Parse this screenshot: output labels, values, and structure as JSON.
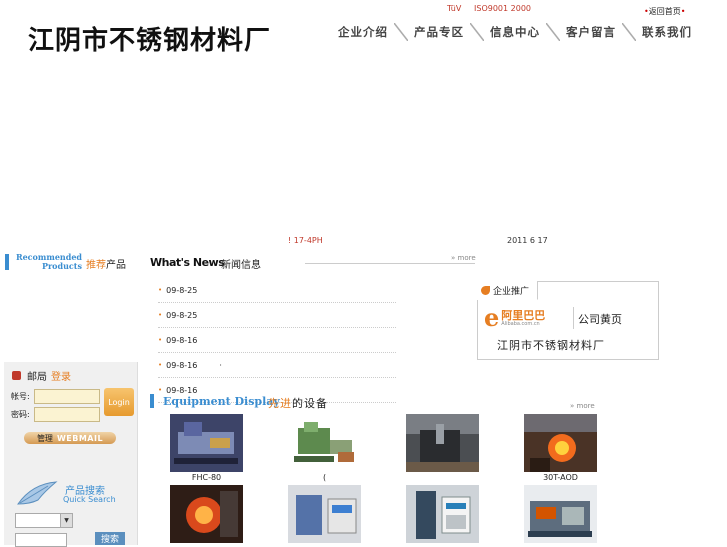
{
  "header": {
    "site_title": "江阴市不锈钢材料厂",
    "cert_tuv": "TüV",
    "cert_iso": "ISO9001 2000",
    "back_home": "返回首页",
    "nav": [
      "企业介绍",
      "产品专区",
      "信息中心",
      "客户留言",
      "联系我们"
    ]
  },
  "info_bar": {
    "hours": "! 17-4PH",
    "date": "2011 6 17"
  },
  "recommended": {
    "title_en_line1": "Recommended",
    "title_en_line2": "Products",
    "title_cn_highlight": "推荐",
    "title_cn_rest": "产品"
  },
  "news": {
    "title_en": "What's News",
    "title_cn": "新闻信息",
    "more": "more",
    "items": [
      "09-8-25",
      "09-8-25",
      "09-8-16",
      "09-8-16",
      "09-8-16"
    ],
    "item_suffix_4": "·"
  },
  "promo": {
    "tab_label": "企业推广",
    "alibaba_cn": "阿里巴巴",
    "alibaba_en": "Alibaba.com.cn",
    "yellow_pages": "公司黄页",
    "company": "江阴市不锈钢材料厂"
  },
  "equipment": {
    "title_en": "Equipment Display",
    "title_cn_highlight": "先进",
    "title_cn_rest": "的设备",
    "more": "more",
    "captions": [
      "FHC-80",
      "(",
      "",
      "30T-AOD",
      "",
      "",
      "",
      ""
    ]
  },
  "mail": {
    "title": "邮局",
    "login_link": "登录",
    "account_label": "帐号:",
    "password_label": "密码:",
    "login_button": "Login",
    "manage_label": "管理",
    "webmail_label": "WEBMAIL"
  },
  "search": {
    "title_cn": "产品搜索",
    "title_en": "Quick Search",
    "button": "搜索"
  },
  "colors": {
    "accent_orange": "#e67e22",
    "accent_blue": "#3a8dd0",
    "red": "#c0392b"
  }
}
